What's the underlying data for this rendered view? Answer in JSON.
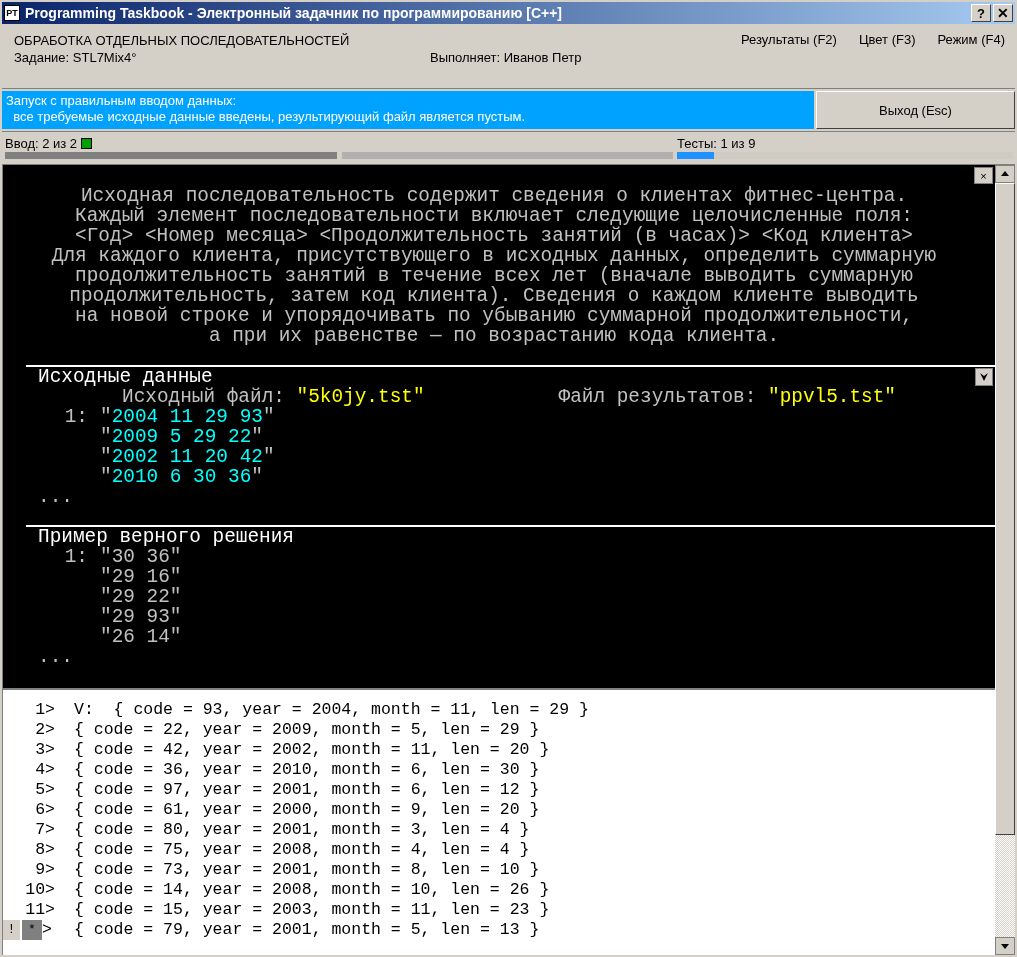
{
  "window": {
    "icon_text": "PT",
    "title": "Programming Taskbook - Электронный задачник по программированию [C++]",
    "buttons": [
      "?",
      "✕"
    ]
  },
  "header": {
    "group": "ОБРАБОТКА ОТДЕЛЬНЫХ ПОСЛЕДОВАТЕЛЬНОСТЕЙ",
    "task": "Задание: STL7Mix4°",
    "student": "Выполняет: Иванов Петр",
    "menu": [
      "Результаты (F2)",
      "Цвет (F3)",
      "Режим (F4)"
    ]
  },
  "message": {
    "lines": [
      "Запуск с правильным вводом данных:",
      "  все требуемые исходные данные введены, результирующий файл является пустым."
    ],
    "exit_button": "Выход (Esc)"
  },
  "progress": {
    "input_label": "Ввод: 2 из 2",
    "input_complete": true,
    "input_segments": [
      {
        "filled": true
      },
      {
        "filled": false
      }
    ],
    "tests_label": "Тесты: 1 из 9",
    "tests": {
      "level": 0.111
    }
  },
  "description": {
    "close": "×",
    "lines": [
      "Исходная последовательность содержит сведения о клиентах фитнес-центра.",
      "Каждый элемент последовательности включает следующие целочисленные поля:",
      "<Год> <Номер месяца> <Продолжительность занятий (в часах)> <Код клиента>",
      "Для каждого клиента, присутствующего в исходных данных, определить суммарную",
      "продолжительность занятий в течение всех лет (вначале выводить суммарную",
      "продолжительность, затем код клиента). Сведения о каждом клиенте выводить",
      "на новой строке и упорядочивать по убыванию суммарной продолжительности,",
      "а при их равенстве — по возрастанию кода клиента."
    ]
  },
  "input_section": {
    "title": "Исходные данные",
    "input_file_label": "Исходный файл: ",
    "input_file": "\"5k0jy.tst\"",
    "result_file_label": "Файл результатов: ",
    "result_file": "\"ppvl5.tst\"",
    "number": "1:",
    "rows": [
      "\"2004 11 29 93\"",
      "\"2009 5 29 22\"",
      "\"2002 11 20 42\"",
      "\"2010 6 30 36\""
    ],
    "more": "..."
  },
  "example_section": {
    "title": "Пример верного решения",
    "number": "1:",
    "rows": [
      "\"30 36\"",
      "\"29 16\"",
      "\"29 22\"",
      "\"29 93\"",
      "\"26 14\""
    ],
    "more": "..."
  },
  "log": [
    {
      "kind": "numbered",
      "number": "1>",
      "text": "V:  { code = 93, year = 2004, month = 11, len = 29 }"
    },
    {
      "kind": "numbered",
      "number": "2>",
      "text": "{ code = 22, year = 2009, month = 5, len = 29 }"
    },
    {
      "kind": "numbered",
      "number": "3>",
      "text": "{ code = 42, year = 2002, month = 11, len = 20 }"
    },
    {
      "kind": "numbered",
      "number": "4>",
      "text": "{ code = 36, year = 2010, month = 6, len = 30 }"
    },
    {
      "kind": "numbered",
      "number": "5>",
      "text": "{ code = 97, year = 2001, month = 6, len = 12 }"
    },
    {
      "kind": "numbered",
      "number": "6>",
      "text": "{ code = 61, year = 2000, month = 9, len = 20 }"
    },
    {
      "kind": "numbered",
      "number": "7>",
      "text": "{ code = 80, year = 2001, month = 3, len = 4 }"
    },
    {
      "kind": "numbered",
      "number": "8>",
      "text": "{ code = 75, year = 2008, month = 4, len = 4 }"
    },
    {
      "kind": "numbered",
      "number": "9>",
      "text": "{ code = 73, year = 2001, month = 8, len = 10 }"
    },
    {
      "kind": "numbered",
      "number": "10>",
      "text": "{ code = 14, year = 2008, month = 10, len = 26 }"
    },
    {
      "kind": "numbered",
      "number": "11>",
      "text": "{ code = 15, year = 2003, month = 11, len = 23 }"
    },
    {
      "kind": "marked",
      "flag": "!",
      "marker": "*",
      "number": ">",
      "text": "{ code = 79, year = 2001, month = 5, len = 13 }"
    }
  ]
}
